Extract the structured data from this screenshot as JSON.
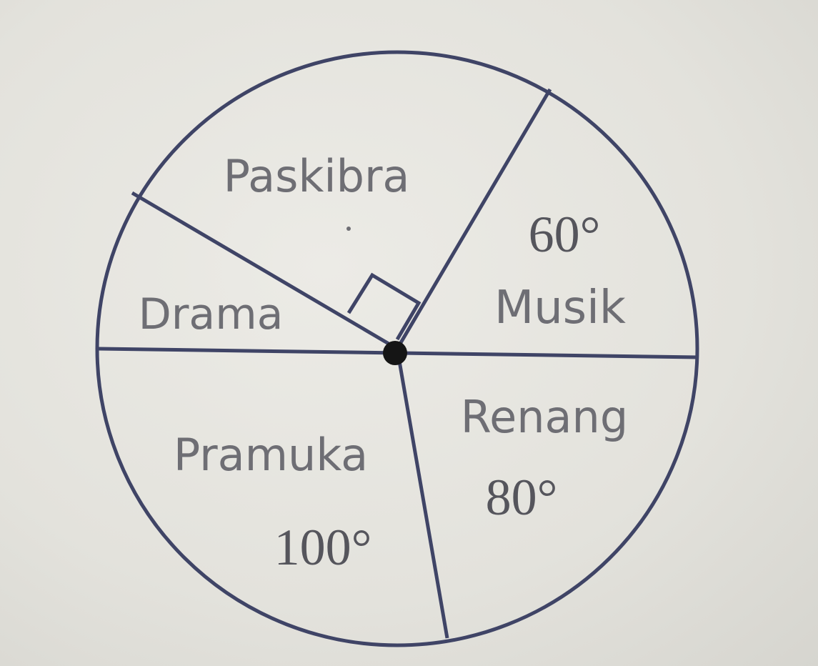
{
  "pie": {
    "segments": [
      {
        "key": "paskibra",
        "label": "Paskibra",
        "angle_deg": 90,
        "value_text": ""
      },
      {
        "key": "musik",
        "label": "Musik",
        "angle_deg": 60,
        "value_text": "60°"
      },
      {
        "key": "renang",
        "label": "Renang",
        "angle_deg": 80,
        "value_text": "80°"
      },
      {
        "key": "pramuka",
        "label": "Pramuka",
        "angle_deg": 100,
        "value_text": "100°"
      },
      {
        "key": "drama",
        "label": "Drama",
        "angle_deg": 30,
        "value_text": ""
      }
    ],
    "right_angle_marker_segment": "paskibra"
  },
  "colors": {
    "line": "#3f4466",
    "label": "#6e6e74",
    "value": "#55555c",
    "center_dot": "#151515"
  }
}
